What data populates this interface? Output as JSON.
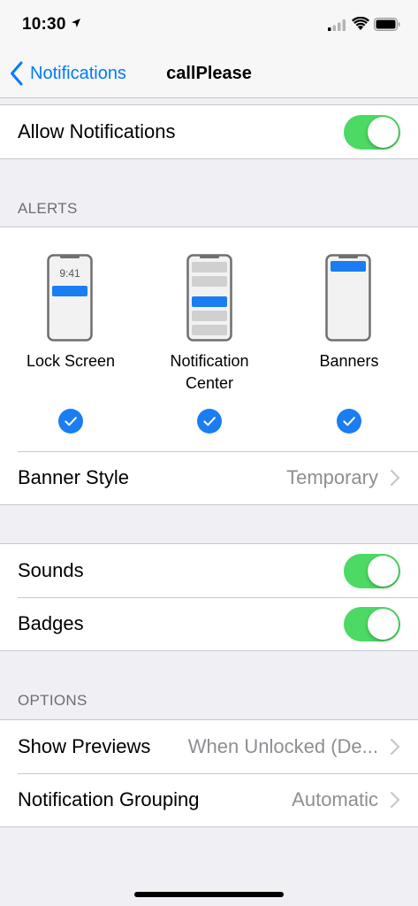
{
  "status_bar": {
    "time": "10:30"
  },
  "nav": {
    "back_label": "Notifications",
    "title": "callPlease"
  },
  "allow_notifications": {
    "label": "Allow Notifications",
    "enabled": true
  },
  "alerts": {
    "header": "ALERTS",
    "lock_screen_time": "9:41",
    "options": [
      {
        "label": "Lock Screen",
        "checked": true
      },
      {
        "label": "Notification\nCenter",
        "checked": true
      },
      {
        "label": "Banners",
        "checked": true
      }
    ],
    "banner_style": {
      "label": "Banner Style",
      "value": "Temporary"
    }
  },
  "sounds": {
    "label": "Sounds",
    "enabled": true
  },
  "badges": {
    "label": "Badges",
    "enabled": true
  },
  "options": {
    "header": "OPTIONS",
    "show_previews": {
      "label": "Show Previews",
      "value": "When Unlocked (De..."
    },
    "grouping": {
      "label": "Notification Grouping",
      "value": "Automatic"
    }
  },
  "colors": {
    "accent": "#007aff",
    "toggle_on": "#4cd964",
    "background": "#efeff4"
  },
  "icons": [
    "location-arrow-icon",
    "signal-icon",
    "wifi-icon",
    "battery-icon",
    "chevron-left-icon",
    "chevron-right-icon",
    "checkmark-icon"
  ]
}
